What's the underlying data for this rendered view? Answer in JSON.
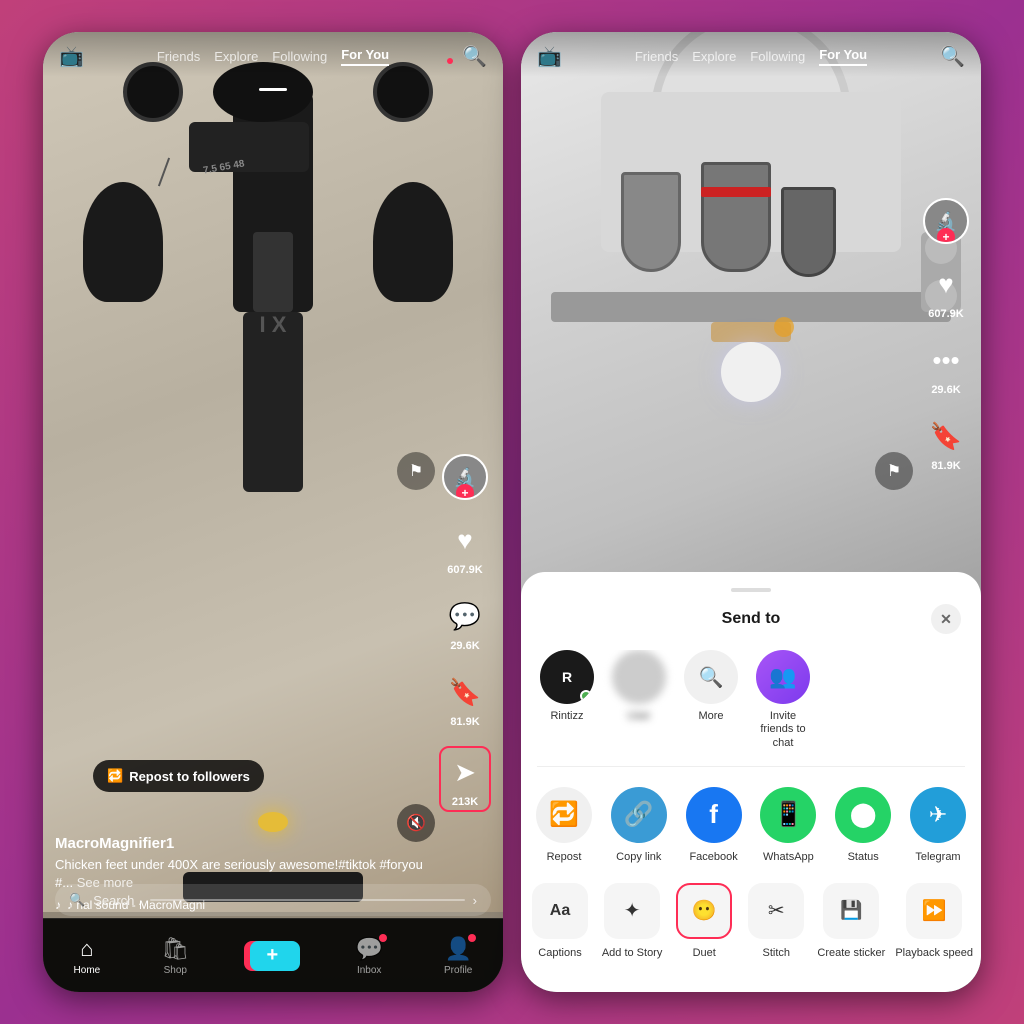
{
  "left_phone": {
    "nav": {
      "icon": "📺",
      "tabs": [
        "Friends",
        "Explore",
        "Following",
        "For You"
      ],
      "active_tab": "For You"
    },
    "video": {
      "username": "MacroMagnifier1",
      "caption": "Chicken feet under 400X are seriously awesome!#tiktok #foryou #...",
      "see_more": "See more",
      "sound": "♪ nal sound - MacroMagni",
      "likes": "607.9K",
      "comments": "29.6K",
      "bookmarks": "81.9K",
      "shares": "213K"
    },
    "repost_bubble": "Repost to followers",
    "search_placeholder": "Search .",
    "bottom_nav": [
      {
        "icon": "🏠",
        "label": "Home",
        "active": true
      },
      {
        "icon": "🛍",
        "label": "Shop",
        "active": false
      },
      {
        "icon": "+",
        "label": "",
        "active": false,
        "is_add": true
      },
      {
        "icon": "💬",
        "label": "Inbox",
        "active": false,
        "dot": true
      },
      {
        "icon": "👤",
        "label": "Profile",
        "active": false,
        "dot": true
      }
    ]
  },
  "right_phone": {
    "nav": {
      "icon": "📺",
      "tabs": [
        "Friends",
        "Explore",
        "Following",
        "For You"
      ],
      "active_tab": "For You"
    },
    "video": {
      "likes": "607.9K",
      "comments": "29.6K",
      "bookmarks": "81.9K"
    },
    "share_sheet": {
      "title": "Send to",
      "close": "✕",
      "recipients": [
        {
          "name": "R",
          "label": "Rintizz",
          "has_dot": true
        },
        {
          "name": "🔍",
          "label": "More",
          "is_more": true
        },
        {
          "name": "👤+",
          "label": "Invite friends to chat",
          "is_invite": true
        }
      ],
      "apps": [
        {
          "icon": "🔁",
          "label": "Repost",
          "color": "repost"
        },
        {
          "icon": "🔗",
          "label": "Copy link",
          "color": "copylink"
        },
        {
          "icon": "f",
          "label": "Facebook",
          "color": "facebook"
        },
        {
          "icon": "📱",
          "label": "WhatsApp",
          "color": "whatsapp"
        },
        {
          "icon": "🟢",
          "label": "Status",
          "color": "status"
        },
        {
          "icon": "✈",
          "label": "Telegram",
          "color": "telegram"
        }
      ],
      "actions": [
        {
          "icon": "Aa",
          "label": "Captions"
        },
        {
          "icon": "✦",
          "label": "Add to Story"
        },
        {
          "icon": "😶",
          "label": "Duet",
          "highlighted": true
        },
        {
          "icon": "✂",
          "label": "Stitch"
        },
        {
          "icon": "💾",
          "label": "Create sticker"
        },
        {
          "icon": "⏩",
          "label": "Playback speed"
        }
      ]
    }
  }
}
